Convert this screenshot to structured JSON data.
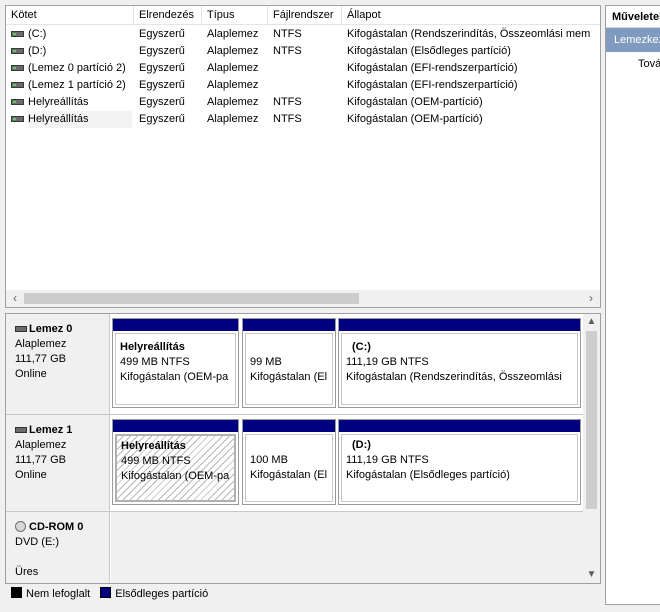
{
  "volume_list": {
    "columns": [
      "Kötet",
      "Elrendezés",
      "Típus",
      "Fájlrendszer",
      "Állapot"
    ],
    "rows": [
      {
        "volume": "(C:)",
        "layout": "Egyszerű",
        "type": "Alaplemez",
        "fs": "NTFS",
        "status": "Kifogástalan (Rendszerindítás, Összeomlási mem"
      },
      {
        "volume": "(D:)",
        "layout": "Egyszerű",
        "type": "Alaplemez",
        "fs": "NTFS",
        "status": "Kifogástalan (Elsődleges partíció)"
      },
      {
        "volume": "(Lemez 0 partíció 2)",
        "layout": "Egyszerű",
        "type": "Alaplemez",
        "fs": "",
        "status": "Kifogástalan (EFI-rendszerpartíció)"
      },
      {
        "volume": "(Lemez 1 partíció 2)",
        "layout": "Egyszerű",
        "type": "Alaplemez",
        "fs": "",
        "status": "Kifogástalan (EFI-rendszerpartíció)"
      },
      {
        "volume": "Helyreállítás",
        "layout": "Egyszerű",
        "type": "Alaplemez",
        "fs": "NTFS",
        "status": "Kifogástalan (OEM-partíció)"
      },
      {
        "volume": "Helyreállítás",
        "layout": "Egyszerű",
        "type": "Alaplemez",
        "fs": "NTFS",
        "status": "Kifogástalan (OEM-partíció)"
      }
    ]
  },
  "disks": [
    {
      "name": "Lemez 0",
      "kind": "Alaplemez",
      "size": "111,77 GB",
      "state": "Online",
      "partitions": [
        {
          "title": "Helyreállítás",
          "line1": "499 MB NTFS",
          "line2": "Kifogástalan (OEM-pa"
        },
        {
          "title": "",
          "line1": "99 MB",
          "line2": "Kifogástalan (El"
        },
        {
          "title": "(C:)",
          "line1": "111,19 GB NTFS",
          "line2": "Kifogástalan (Rendszerindítás, Összeomlási"
        }
      ]
    },
    {
      "name": "Lemez 1",
      "kind": "Alaplemez",
      "size": "111,77 GB",
      "state": "Online",
      "partitions": [
        {
          "title": "Helyreállítás",
          "line1": "499 MB NTFS",
          "line2": "Kifogástalan (OEM-pa"
        },
        {
          "title": "",
          "line1": "100 MB",
          "line2": "Kifogástalan (El"
        },
        {
          "title": "(D:)",
          "line1": "111,19 GB NTFS",
          "line2": "Kifogástalan (Elsődleges partíció)"
        }
      ]
    }
  ],
  "cdrom": {
    "name": "CD-ROM 0",
    "drive": "DVD (E:)",
    "state": "Üres"
  },
  "legend": {
    "unallocated": "Nem lefoglalt",
    "primary": "Elsődleges partíció"
  },
  "actions": {
    "header": "Műveletek",
    "selected": "Lemezkezelés",
    "more": "További műveletek"
  },
  "colors": {
    "primary_partition": "#000080",
    "unallocated": "#000000",
    "selection": "#7f9bbf"
  },
  "icons": {
    "volume": "disk-volume-icon",
    "disk": "hard-disk-icon",
    "cdrom": "cdrom-icon"
  }
}
